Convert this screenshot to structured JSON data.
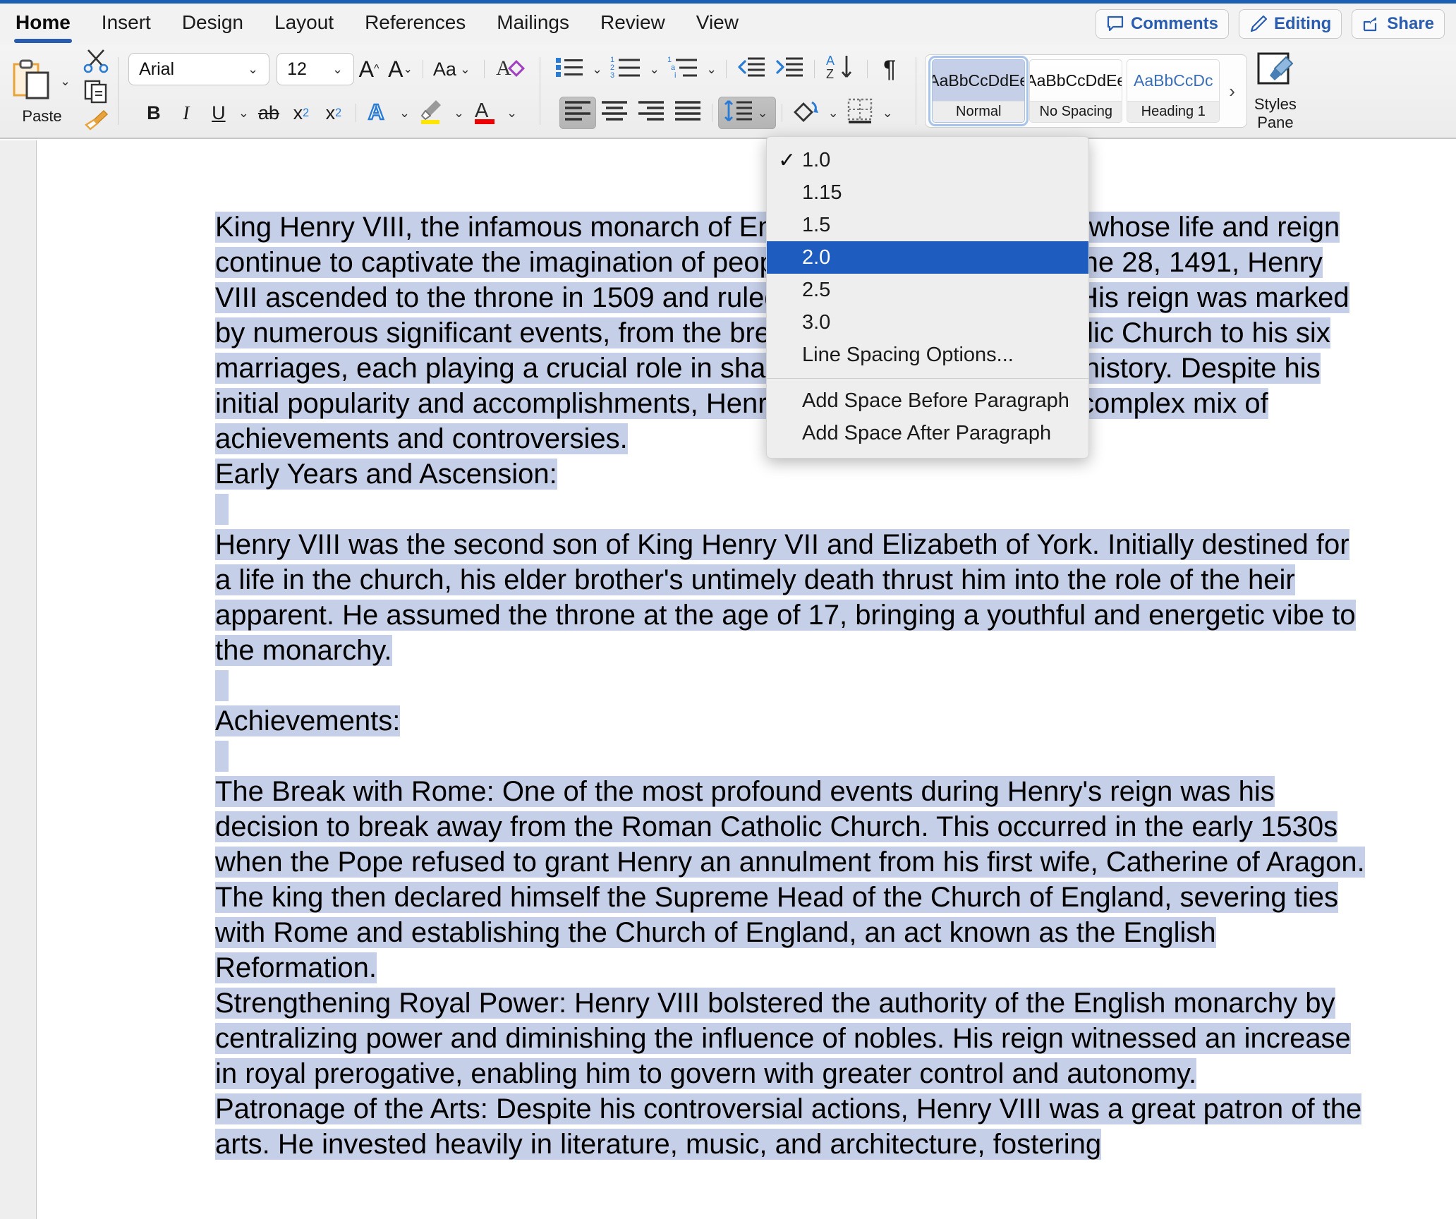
{
  "ribbon": {
    "tabs": [
      {
        "label": "Home",
        "active": true
      },
      {
        "label": "Insert",
        "active": false
      },
      {
        "label": "Design",
        "active": false
      },
      {
        "label": "Layout",
        "active": false
      },
      {
        "label": "References",
        "active": false
      },
      {
        "label": "Mailings",
        "active": false
      },
      {
        "label": "Review",
        "active": false
      },
      {
        "label": "View",
        "active": false
      }
    ],
    "window_buttons": [
      {
        "label": "Comments",
        "icon": "comment-icon"
      },
      {
        "label": "Editing",
        "icon": "pencil-icon"
      },
      {
        "label": "Share",
        "icon": "share-icon"
      }
    ]
  },
  "toolbar": {
    "paste_label": "Paste",
    "cut_icon": "scissors-icon",
    "copy_icon": "copy-icon",
    "format_painter_icon": "format-painter-icon",
    "font_name": "Arial",
    "font_size": "12",
    "grow_font": "A",
    "shrink_font": "A",
    "change_case": "Aa",
    "clear_formatting_icon": "clear-formatting-icon",
    "bold": "B",
    "italic": "I",
    "underline": "U",
    "strikethrough": "ab",
    "subscript": "x",
    "superscript": "x",
    "text_effects": "A",
    "highlight_icon": "text-highlight-icon",
    "font_color": "A",
    "bullets_icon": "bullet-list-icon",
    "numbering_icon": "numbered-list-icon",
    "multilevel_icon": "multilevel-list-icon",
    "decrease_indent_icon": "decrease-indent-icon",
    "increase_indent_icon": "increase-indent-icon",
    "sort_icon": "sort-az-icon",
    "show_marks_icon": "pilcrow-icon",
    "align_left_icon": "align-left-icon",
    "align_center_icon": "align-center-icon",
    "align_right_icon": "align-right-icon",
    "justify_icon": "justify-icon",
    "line_spacing_icon": "line-spacing-icon",
    "shading_icon": "shading-icon",
    "borders_icon": "borders-icon",
    "chevron": "⌄"
  },
  "styles_gallery": {
    "items": [
      {
        "preview": "AaBbCcDdEe",
        "name": "Normal",
        "selected": true,
        "heading": false
      },
      {
        "preview": "AaBbCcDdEe",
        "name": "No Spacing",
        "selected": false,
        "heading": false
      },
      {
        "preview": "AaBbCcDc",
        "name": "Heading 1",
        "selected": false,
        "heading": true
      }
    ],
    "more_arrow": "›",
    "styles_pane_label_line1": "Styles",
    "styles_pane_label_line2": "Pane",
    "styles_pane_icon": "styles-pane-icon"
  },
  "line_spacing_menu": {
    "checkmark": "✓",
    "items": [
      {
        "label": "1.0",
        "checked": true,
        "highlighted": false
      },
      {
        "label": "1.15",
        "checked": false,
        "highlighted": false
      },
      {
        "label": "1.5",
        "checked": false,
        "highlighted": false
      },
      {
        "label": "2.0",
        "checked": false,
        "highlighted": true
      },
      {
        "label": "2.5",
        "checked": false,
        "highlighted": false
      },
      {
        "label": "3.0",
        "checked": false,
        "highlighted": false
      },
      {
        "label": "Line Spacing Options...",
        "checked": false,
        "highlighted": false
      }
    ],
    "extra_items": [
      {
        "label": "Add Space Before Paragraph"
      },
      {
        "label": "Add Space After Paragraph"
      }
    ]
  },
  "document": {
    "paragraphs": [
      {
        "text": "King Henry VIII, the infamous monarch of England, stands as a figure whose life and reign continue to captivate the imagination of people worldwide. Born on June 28, 1491, Henry VIII ascended to the throne in 1509 and ruled until his death in 1547. His reign was marked by numerous significant events, from the break with the Roman Catholic Church to his six marriages, each playing a crucial role in shaping the course of British history. Despite his initial popularity and accomplishments, Henry VIII's legacy remains a complex mix of achievements and controversies.",
        "selected": true
      },
      {
        "text": "Early Years and Ascension:",
        "selected": true
      },
      {
        "text": "",
        "selected": true
      },
      {
        "text": "Henry VIII was the second son of King Henry VII and Elizabeth of York. Initially destined for a life in the church, his elder brother's untimely death thrust him into the role of the heir apparent. He assumed the throne at the age of 17, bringing a youthful and energetic vibe to the monarchy.",
        "selected": true
      },
      {
        "text": "",
        "selected": true
      },
      {
        "text": "Achievements:",
        "selected": true
      },
      {
        "text": "",
        "selected": true
      },
      {
        "text": "The Break with Rome: One of the most profound events during Henry's reign was his decision to break away from the Roman Catholic Church. This occurred in the early 1530s when the Pope refused to grant Henry an annulment from his first wife, Catherine of Aragon. The king then declared himself the Supreme Head of the Church of England, severing ties with Rome and establishing the Church of England, an act known as the English Reformation.",
        "selected": true
      },
      {
        "text": "Strengthening Royal Power: Henry VIII bolstered the authority of the English monarchy by centralizing power and diminishing the influence of nobles. His reign witnessed an increase in royal prerogative, enabling him to govern with greater control and autonomy.",
        "selected": true
      },
      {
        "text": "Patronage of the Arts: Despite his controversial actions, Henry VIII was a great patron of the arts. He invested heavily in literature, music, and architecture, fostering",
        "selected": true
      }
    ]
  },
  "colors": {
    "accent_blue": "#1a5fb4",
    "menu_highlight": "#1e5cc0",
    "selection": "#c5cfe8",
    "tab_underline": "#2a5db0"
  }
}
